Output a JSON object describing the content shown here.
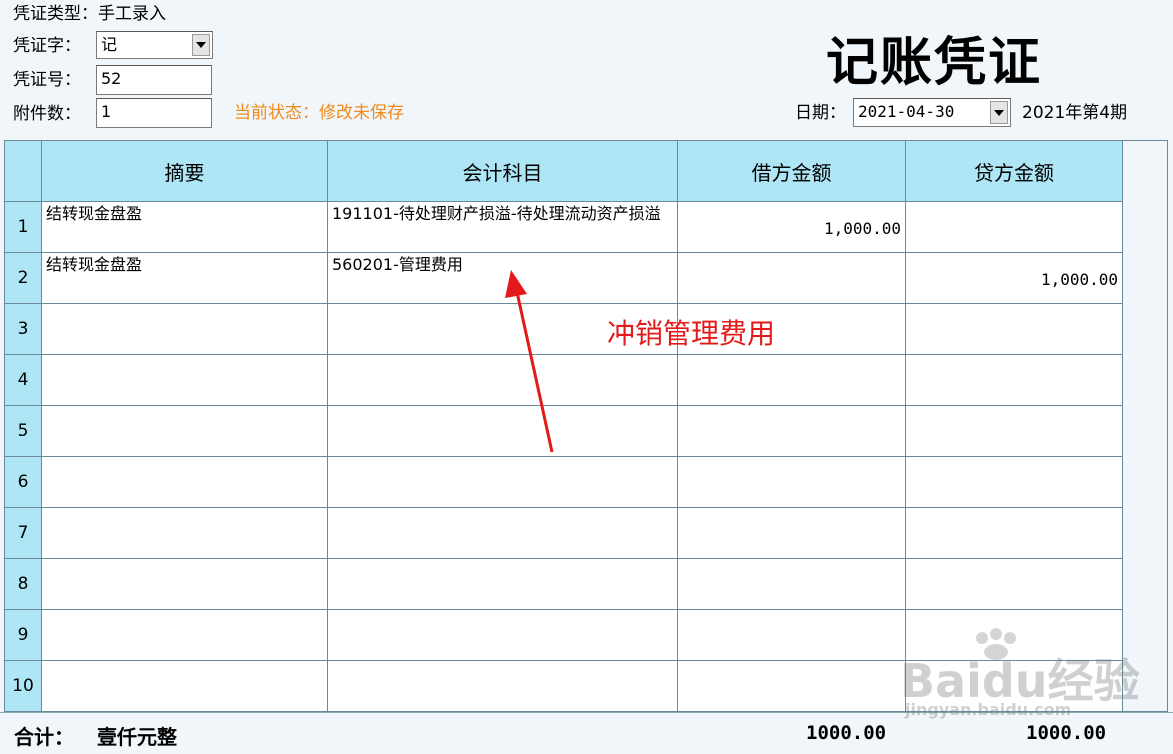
{
  "header": {
    "voucher_type_label": "凭证类型：",
    "voucher_type_value": "手工录入",
    "voucher_word_label": "凭证字：",
    "voucher_word_value": "记",
    "voucher_no_label": "凭证号：",
    "voucher_no_value": "52",
    "attachments_label": "附件数：",
    "attachments_value": "1",
    "status_text": "当前状态：修改未保存",
    "title": "记账凭证",
    "date_label": "日期：",
    "date_value": "2021-04-30",
    "period_text": "2021年第4期"
  },
  "table": {
    "columns": [
      "摘要",
      "会计科目",
      "借方金额",
      "贷方金额"
    ],
    "rows": [
      {
        "no": "1",
        "summary": "结转现金盘盈",
        "account": "191101-待处理财产损溢-待处理流动资产损溢",
        "debit": "1,000.00",
        "credit": ""
      },
      {
        "no": "2",
        "summary": "结转现金盘盈",
        "account": "560201-管理费用",
        "debit": "",
        "credit": "1,000.00"
      },
      {
        "no": "3",
        "summary": "",
        "account": "",
        "debit": "",
        "credit": ""
      },
      {
        "no": "4",
        "summary": "",
        "account": "",
        "debit": "",
        "credit": ""
      },
      {
        "no": "5",
        "summary": "",
        "account": "",
        "debit": "",
        "credit": ""
      },
      {
        "no": "6",
        "summary": "",
        "account": "",
        "debit": "",
        "credit": ""
      },
      {
        "no": "7",
        "summary": "",
        "account": "",
        "debit": "",
        "credit": ""
      },
      {
        "no": "8",
        "summary": "",
        "account": "",
        "debit": "",
        "credit": ""
      },
      {
        "no": "9",
        "summary": "",
        "account": "",
        "debit": "",
        "credit": ""
      },
      {
        "no": "10",
        "summary": "",
        "account": "",
        "debit": "",
        "credit": ""
      }
    ]
  },
  "footer": {
    "total_label": "合计：",
    "total_words": "壹仟元整",
    "debit_total": "1000.00",
    "credit_total": "1000.00"
  },
  "annotation": {
    "text": "冲销管理费用",
    "color": "#e21a1a"
  },
  "watermark": {
    "brand": "Bai",
    "brand2": "du",
    "suffix": "经验",
    "url": "jingyan.baidu.com"
  },
  "colors": {
    "header_bg": "#aee6f5",
    "status": "#f08a1c"
  }
}
